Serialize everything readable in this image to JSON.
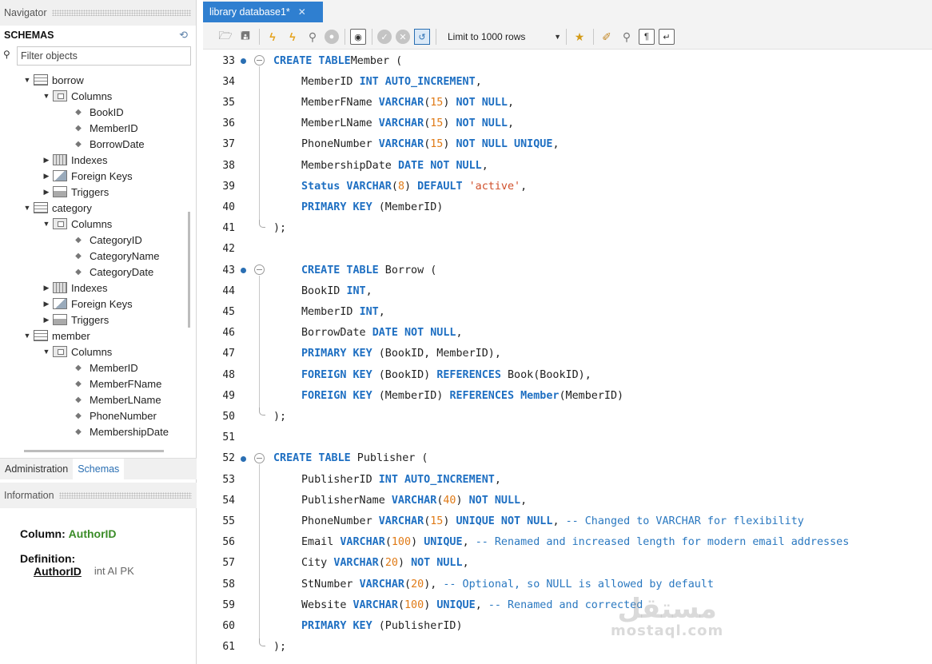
{
  "navigator": {
    "title": "Navigator",
    "schemas_label": "SCHEMAS",
    "filter_placeholder": "Filter objects",
    "tree": [
      {
        "indent": 28,
        "arrow": "▼",
        "icon": "table",
        "label": "borrow"
      },
      {
        "indent": 52,
        "arrow": "▼",
        "icon": "folder",
        "label": "Columns"
      },
      {
        "indent": 92,
        "arrow": "",
        "icon": "column",
        "label": "BookID"
      },
      {
        "indent": 92,
        "arrow": "",
        "icon": "column",
        "label": "MemberID"
      },
      {
        "indent": 92,
        "arrow": "",
        "icon": "column",
        "label": "BorrowDate"
      },
      {
        "indent": 52,
        "arrow": "▶",
        "icon": "index",
        "label": "Indexes"
      },
      {
        "indent": 52,
        "arrow": "▶",
        "icon": "fk",
        "label": "Foreign Keys"
      },
      {
        "indent": 52,
        "arrow": "▶",
        "icon": "trigger",
        "label": "Triggers"
      },
      {
        "indent": 28,
        "arrow": "▼",
        "icon": "table",
        "label": "category"
      },
      {
        "indent": 52,
        "arrow": "▼",
        "icon": "folder",
        "label": "Columns"
      },
      {
        "indent": 92,
        "arrow": "",
        "icon": "column",
        "label": "CategoryID"
      },
      {
        "indent": 92,
        "arrow": "",
        "icon": "column",
        "label": "CategoryName"
      },
      {
        "indent": 92,
        "arrow": "",
        "icon": "column",
        "label": "CategoryDate"
      },
      {
        "indent": 52,
        "arrow": "▶",
        "icon": "index",
        "label": "Indexes"
      },
      {
        "indent": 52,
        "arrow": "▶",
        "icon": "fk",
        "label": "Foreign Keys"
      },
      {
        "indent": 52,
        "arrow": "▶",
        "icon": "trigger",
        "label": "Triggers"
      },
      {
        "indent": 28,
        "arrow": "▼",
        "icon": "table",
        "label": "member"
      },
      {
        "indent": 52,
        "arrow": "▼",
        "icon": "folder",
        "label": "Columns"
      },
      {
        "indent": 92,
        "arrow": "",
        "icon": "column",
        "label": "MemberID"
      },
      {
        "indent": 92,
        "arrow": "",
        "icon": "column",
        "label": "MemberFName"
      },
      {
        "indent": 92,
        "arrow": "",
        "icon": "column",
        "label": "MemberLName"
      },
      {
        "indent": 92,
        "arrow": "",
        "icon": "column",
        "label": "PhoneNumber"
      },
      {
        "indent": 92,
        "arrow": "",
        "icon": "column",
        "label": "MembershipDate"
      }
    ],
    "tabs": {
      "administration": "Administration",
      "schemas": "Schemas"
    }
  },
  "information": {
    "title": "Information",
    "column_label": "Column:",
    "column_name": "AuthorID",
    "definition_label": "Definition:",
    "definition_name": "AuthorID",
    "definition_type": "int AI PK"
  },
  "editor": {
    "tab_title": "library database1*",
    "limit_label": "Limit to 1000 rows",
    "lines": [
      {
        "n": "33",
        "dot": true,
        "fold": "start",
        "indent": 0,
        "tokens": [
          [
            "kw",
            "CREATE TABLE"
          ],
          [
            "",
            "Member ("
          ]
        ]
      },
      {
        "n": "34",
        "dot": false,
        "fold": "",
        "indent": 1,
        "tokens": [
          [
            "",
            "MemberID "
          ],
          [
            "kw",
            "INT AUTO_INCREMENT"
          ],
          [
            "",
            ","
          ]
        ]
      },
      {
        "n": "35",
        "dot": false,
        "fold": "",
        "indent": 1,
        "tokens": [
          [
            "",
            "MemberFName "
          ],
          [
            "kw",
            "VARCHAR"
          ],
          [
            "",
            "("
          ],
          [
            "num",
            "15"
          ],
          [
            "",
            ") "
          ],
          [
            "kw",
            "NOT NULL"
          ],
          [
            "",
            ","
          ]
        ]
      },
      {
        "n": "36",
        "dot": false,
        "fold": "",
        "indent": 1,
        "tokens": [
          [
            "",
            "MemberLName "
          ],
          [
            "kw",
            "VARCHAR"
          ],
          [
            "",
            "("
          ],
          [
            "num",
            "15"
          ],
          [
            "",
            ") "
          ],
          [
            "kw",
            "NOT NULL"
          ],
          [
            "",
            ","
          ]
        ]
      },
      {
        "n": "37",
        "dot": false,
        "fold": "",
        "indent": 1,
        "tokens": [
          [
            "",
            "PhoneNumber "
          ],
          [
            "kw",
            "VARCHAR"
          ],
          [
            "",
            "("
          ],
          [
            "num",
            "15"
          ],
          [
            "",
            ") "
          ],
          [
            "kw",
            "NOT NULL UNIQUE"
          ],
          [
            "",
            ","
          ]
        ]
      },
      {
        "n": "38",
        "dot": false,
        "fold": "",
        "indent": 1,
        "tokens": [
          [
            "",
            "MembershipDate "
          ],
          [
            "kw",
            "DATE NOT NULL"
          ],
          [
            "",
            ","
          ]
        ]
      },
      {
        "n": "39",
        "dot": false,
        "fold": "",
        "indent": 1,
        "tokens": [
          [
            "kw",
            "Status VARCHAR"
          ],
          [
            "",
            "("
          ],
          [
            "num",
            "8"
          ],
          [
            "",
            ") "
          ],
          [
            "kw",
            "DEFAULT"
          ],
          [
            "str",
            " 'active'"
          ],
          [
            "",
            ","
          ]
        ]
      },
      {
        "n": "40",
        "dot": false,
        "fold": "",
        "indent": 1,
        "tokens": [
          [
            "kw",
            "PRIMARY KEY"
          ],
          [
            "",
            " (MemberID)"
          ]
        ]
      },
      {
        "n": "41",
        "dot": false,
        "fold": "end",
        "indent": 0,
        "tokens": [
          [
            "",
            ");"
          ]
        ]
      },
      {
        "n": "42",
        "dot": false,
        "fold": "",
        "indent": 0,
        "tokens": []
      },
      {
        "n": "43",
        "dot": true,
        "fold": "start",
        "indent": 1,
        "tokens": [
          [
            "kw",
            "CREATE TABLE"
          ],
          [
            "",
            " Borrow ("
          ]
        ]
      },
      {
        "n": "44",
        "dot": false,
        "fold": "",
        "indent": 1,
        "tokens": [
          [
            "",
            "BookID "
          ],
          [
            "kw",
            "INT"
          ],
          [
            "",
            ","
          ]
        ]
      },
      {
        "n": "45",
        "dot": false,
        "fold": "",
        "indent": 1,
        "tokens": [
          [
            "",
            "MemberID "
          ],
          [
            "kw",
            "INT"
          ],
          [
            "",
            ","
          ]
        ]
      },
      {
        "n": "46",
        "dot": false,
        "fold": "",
        "indent": 1,
        "tokens": [
          [
            "",
            "BorrowDate "
          ],
          [
            "kw",
            "DATE NOT NULL"
          ],
          [
            "",
            ","
          ]
        ]
      },
      {
        "n": "47",
        "dot": false,
        "fold": "",
        "indent": 1,
        "tokens": [
          [
            "kw",
            "PRIMARY KEY"
          ],
          [
            "",
            " (BookID, MemberID),"
          ]
        ]
      },
      {
        "n": "48",
        "dot": false,
        "fold": "",
        "indent": 1,
        "tokens": [
          [
            "kw",
            "FOREIGN KEY"
          ],
          [
            "",
            " (BookID) "
          ],
          [
            "kw",
            "REFERENCES"
          ],
          [
            "",
            " Book(BookID),"
          ]
        ]
      },
      {
        "n": "49",
        "dot": false,
        "fold": "",
        "indent": 1,
        "tokens": [
          [
            "kw",
            "FOREIGN KEY"
          ],
          [
            "",
            " (MemberID) "
          ],
          [
            "kw",
            "REFERENCES Member"
          ],
          [
            "",
            "(MemberID)"
          ]
        ]
      },
      {
        "n": "50",
        "dot": false,
        "fold": "end",
        "indent": 0,
        "tokens": [
          [
            "",
            ");"
          ]
        ]
      },
      {
        "n": "51",
        "dot": false,
        "fold": "",
        "indent": 0,
        "tokens": []
      },
      {
        "n": "52",
        "dot": true,
        "fold": "start",
        "indent": 0,
        "tokens": [
          [
            "kw",
            "CREATE TABLE"
          ],
          [
            "",
            " Publisher ("
          ]
        ]
      },
      {
        "n": "53",
        "dot": false,
        "fold": "",
        "indent": 1,
        "tokens": [
          [
            "",
            "PublisherID "
          ],
          [
            "kw",
            "INT AUTO_INCREMENT"
          ],
          [
            "",
            ","
          ]
        ]
      },
      {
        "n": "54",
        "dot": false,
        "fold": "",
        "indent": 1,
        "tokens": [
          [
            "",
            "PublisherName "
          ],
          [
            "kw",
            "VARCHAR"
          ],
          [
            "",
            "("
          ],
          [
            "num",
            "40"
          ],
          [
            "",
            ") "
          ],
          [
            "kw",
            "NOT NULL"
          ],
          [
            "",
            ","
          ]
        ]
      },
      {
        "n": "55",
        "dot": false,
        "fold": "",
        "indent": 1,
        "tokens": [
          [
            "",
            "PhoneNumber "
          ],
          [
            "kw",
            "VARCHAR"
          ],
          [
            "",
            "("
          ],
          [
            "num",
            "15"
          ],
          [
            "",
            ") "
          ],
          [
            "kw",
            "UNIQUE NOT NULL"
          ],
          [
            "",
            ", "
          ],
          [
            "cmt",
            "-- Changed to VARCHAR for flexibility"
          ]
        ]
      },
      {
        "n": "56",
        "dot": false,
        "fold": "",
        "indent": 1,
        "tokens": [
          [
            "",
            "Email "
          ],
          [
            "kw",
            "VARCHAR"
          ],
          [
            "",
            "("
          ],
          [
            "num",
            "100"
          ],
          [
            "",
            ") "
          ],
          [
            "kw",
            "UNIQUE"
          ],
          [
            "",
            ", "
          ],
          [
            "cmt",
            "-- Renamed and increased length for modern email addresses"
          ]
        ]
      },
      {
        "n": "57",
        "dot": false,
        "fold": "",
        "indent": 1,
        "tokens": [
          [
            "",
            "City "
          ],
          [
            "kw",
            "VARCHAR"
          ],
          [
            "",
            "("
          ],
          [
            "num",
            "20"
          ],
          [
            "",
            ") "
          ],
          [
            "kw",
            "NOT NULL"
          ],
          [
            "",
            ","
          ]
        ]
      },
      {
        "n": "58",
        "dot": false,
        "fold": "",
        "indent": 1,
        "tokens": [
          [
            "",
            "StNumber "
          ],
          [
            "kw",
            "VARCHAR"
          ],
          [
            "",
            "("
          ],
          [
            "num",
            "20"
          ],
          [
            "",
            "), "
          ],
          [
            "cmt",
            "-- Optional, so NULL is allowed by default"
          ]
        ]
      },
      {
        "n": "59",
        "dot": false,
        "fold": "",
        "indent": 1,
        "tokens": [
          [
            "",
            "Website "
          ],
          [
            "kw",
            "VARCHAR"
          ],
          [
            "",
            "("
          ],
          [
            "num",
            "100"
          ],
          [
            "",
            ") "
          ],
          [
            "kw",
            "UNIQUE"
          ],
          [
            "",
            ", "
          ],
          [
            "cmt",
            "-- Renamed and corrected"
          ]
        ]
      },
      {
        "n": "60",
        "dot": false,
        "fold": "",
        "indent": 1,
        "tokens": [
          [
            "kw",
            "PRIMARY KEY"
          ],
          [
            "",
            " (PublisherID)"
          ]
        ]
      },
      {
        "n": "61",
        "dot": false,
        "fold": "end",
        "indent": 0,
        "tokens": [
          [
            "",
            ");"
          ]
        ]
      }
    ]
  },
  "watermark": {
    "arabic": "مستقل",
    "latin": "mostaql.com"
  },
  "colors": {
    "accent": "#2f7fd0",
    "keyword": "#1e6fc2",
    "number": "#e07b17",
    "string": "#d04f2a",
    "comment": "#2a78c0",
    "info_green": "#3a8c27"
  }
}
